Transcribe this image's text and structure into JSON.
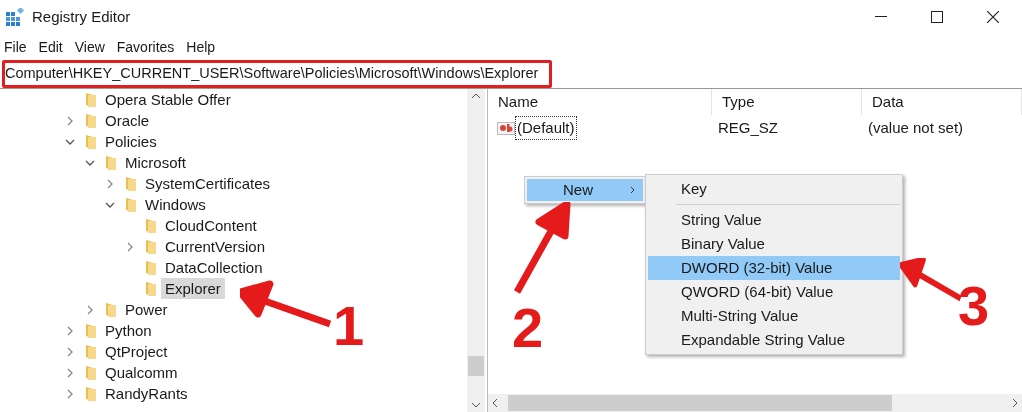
{
  "window": {
    "title": "Registry Editor"
  },
  "menu": [
    "File",
    "Edit",
    "View",
    "Favorites",
    "Help"
  ],
  "address": {
    "value": "Computer\\HKEY_CURRENT_USER\\Software\\Policies\\Microsoft\\Windows\\Explorer",
    "highlighted": true
  },
  "tree": [
    {
      "label": "Opera Stable Offer",
      "kind": "leaf",
      "selected": false
    },
    {
      "label": "Oracle",
      "kind": "branch",
      "expanded": false,
      "selected": false
    },
    {
      "label": "Policies",
      "kind": "branch",
      "expanded": true,
      "selected": false,
      "children": [
        {
          "label": "Microsoft",
          "kind": "branch",
          "expanded": true,
          "selected": false,
          "children": [
            {
              "label": "SystemCertificates",
              "kind": "branch",
              "expanded": false,
              "selected": false
            },
            {
              "label": "Windows",
              "kind": "branch",
              "expanded": true,
              "selected": false,
              "children": [
                {
                  "label": "CloudContent",
                  "kind": "leaf",
                  "selected": false
                },
                {
                  "label": "CurrentVersion",
                  "kind": "branch",
                  "expanded": false,
                  "selected": false
                },
                {
                  "label": "DataCollection",
                  "kind": "leaf",
                  "selected": false
                },
                {
                  "label": "Explorer",
                  "kind": "leaf",
                  "selected": true
                }
              ]
            }
          ]
        },
        {
          "label": "Power",
          "kind": "branch",
          "expanded": false,
          "selected": false
        }
      ]
    },
    {
      "label": "Python",
      "kind": "branch",
      "expanded": false,
      "selected": false
    },
    {
      "label": "QtProject",
      "kind": "branch",
      "expanded": false,
      "selected": false
    },
    {
      "label": "Qualcomm",
      "kind": "branch",
      "expanded": false,
      "selected": false
    },
    {
      "label": "RandyRants",
      "kind": "branch",
      "expanded": false,
      "selected": false
    }
  ],
  "values": {
    "columns": [
      "Name",
      "Type",
      "Data"
    ],
    "rows": [
      {
        "name": "(Default)",
        "type": "REG_SZ",
        "data": "(value not set)",
        "focused": true
      }
    ]
  },
  "context_menu": {
    "items": [
      {
        "label": "New",
        "selected": true,
        "has_submenu": true
      }
    ],
    "submenu": [
      {
        "kind": "item",
        "label": "Key",
        "selected": false
      },
      {
        "kind": "separator"
      },
      {
        "kind": "item",
        "label": "String Value",
        "selected": false
      },
      {
        "kind": "item",
        "label": "Binary Value",
        "selected": false
      },
      {
        "kind": "item",
        "label": "DWORD (32-bit) Value",
        "selected": true
      },
      {
        "kind": "item",
        "label": "QWORD (64-bit) Value",
        "selected": false
      },
      {
        "kind": "item",
        "label": "Multi-String Value",
        "selected": false
      },
      {
        "kind": "item",
        "label": "Expandable String Value",
        "selected": false
      }
    ]
  },
  "annotations": [
    {
      "label": "1"
    },
    {
      "label": "2"
    },
    {
      "label": "3"
    }
  ]
}
